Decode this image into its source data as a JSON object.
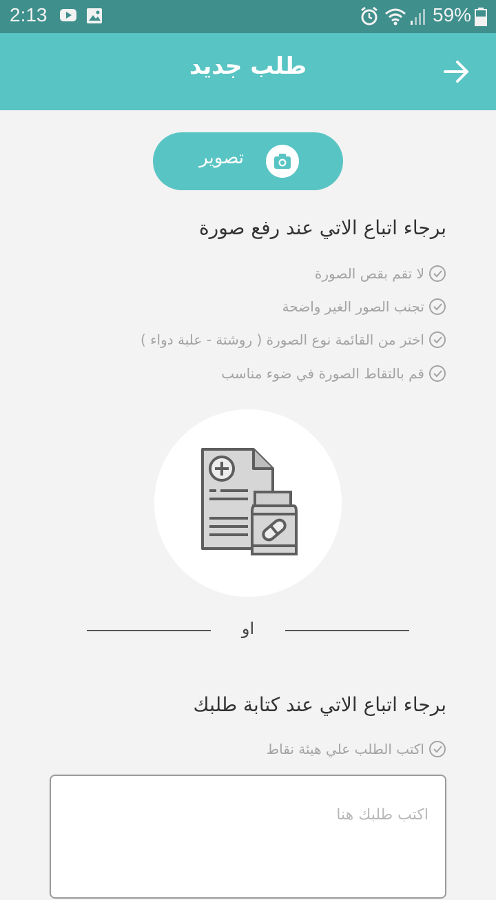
{
  "status_bar": {
    "time": "2:13",
    "battery": "59%",
    "icons": [
      "youtube-icon",
      "image-icon",
      "alarm-icon",
      "wifi-icon",
      "signal-icon",
      "battery-icon"
    ]
  },
  "app_bar": {
    "title": "طلب جديد",
    "back_icon": "arrow-right-icon",
    "background": "#58c4c3"
  },
  "capture_button": {
    "label": "تصوير",
    "icon": "camera-icon"
  },
  "image_section": {
    "heading": "برجاء اتباع الاتي عند رفع صورة",
    "rules": [
      "لا تقم بقص الصورة",
      "تجنب الصور الغير واضحة",
      "اختر من القائمة نوع الصورة ( روشتة - علبة دواء )",
      "قم بالتقاط الصورة في ضوء مناسب"
    ],
    "illustration_icon": "prescription-medicine-icon"
  },
  "divider": {
    "label": "او"
  },
  "text_section": {
    "heading": "برجاء اتباع الاتي عند كتابة طلبك",
    "rules": [
      "اكتب الطلب علي هيئة نقاط"
    ],
    "input_placeholder": "اكتب طلبك هنا",
    "input_value": ""
  }
}
